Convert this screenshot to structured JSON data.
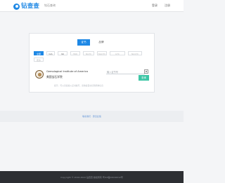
{
  "header": {
    "logo_text": "钻查查",
    "subtitle": "钻石查询",
    "nav": [
      "登录",
      "注册"
    ]
  },
  "search_modes": {
    "active": "证书",
    "inactive": "品牌"
  },
  "lab_chips": [
    "全部",
    "GIA",
    "IGI",
    "HRD",
    "NGTC",
    "NGDTC",
    "GTC",
    "NGSTC",
    "更多"
  ],
  "result": {
    "name_en": "Gemological Institute of America",
    "name_cn": "美国宝石学院"
  },
  "search": {
    "placeholder": "输入证书号",
    "button": "查询"
  },
  "hint": "提示：可以直接输入证书编号，系统会自动识别机构信息",
  "footer": {
    "links": "联系我们 · 意见反馈"
  },
  "bottom": {
    "copyright": "Copyright © 2016-2022 钻查查 版权所有 粤ICP备16016012号"
  },
  "colors": {
    "primary": "#1e88e5",
    "search_button": "#3ec6a6",
    "bottom_bar": "#2d2f33"
  }
}
